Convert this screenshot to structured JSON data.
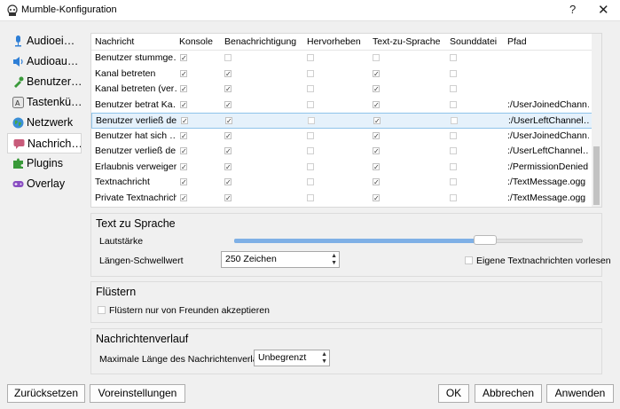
{
  "window": {
    "title": "Mumble-Konfiguration",
    "help": "?",
    "close": "✕"
  },
  "sidebar": {
    "items": [
      {
        "label": "Audioei…",
        "icon": "microphone-icon"
      },
      {
        "label": "Audioau…",
        "icon": "speaker-icon"
      },
      {
        "label": "Benutzer…",
        "icon": "user-interface-icon"
      },
      {
        "label": "Tastenkü…",
        "icon": "keyboard-icon"
      },
      {
        "label": "Netzwerk",
        "icon": "globe-icon"
      },
      {
        "label": "Nachrich…",
        "icon": "message-bubble-icon"
      },
      {
        "label": "Plugins",
        "icon": "puzzle-icon"
      },
      {
        "label": "Overlay",
        "icon": "gamepad-icon"
      }
    ],
    "selected_index": 5
  },
  "messages_table": {
    "headers": [
      "Nachricht",
      "Konsole",
      "Benachrichtigung",
      "Hervorheben",
      "Text-zu-Sprache",
      "Sounddatei",
      "Pfad"
    ],
    "rows": [
      {
        "message": "Benutzer stummge…",
        "console": true,
        "notification": false,
        "highlight": false,
        "tts": false,
        "sound": false,
        "path": ""
      },
      {
        "message": "Kanal betreten",
        "console": true,
        "notification": true,
        "highlight": false,
        "tts": true,
        "sound": false,
        "path": ""
      },
      {
        "message": "Kanal betreten (ver…",
        "console": true,
        "notification": true,
        "highlight": false,
        "tts": true,
        "sound": false,
        "path": ""
      },
      {
        "message": "Benutzer betrat Ka…",
        "console": true,
        "notification": true,
        "highlight": false,
        "tts": true,
        "sound": false,
        "path": ":/UserJoinedChann…"
      },
      {
        "message": "Benutzer verließ de…",
        "console": true,
        "notification": true,
        "highlight": false,
        "tts": true,
        "sound": false,
        "path": ":/UserLeftChannel…",
        "selected": true
      },
      {
        "message": "Benutzer hat sich …",
        "console": true,
        "notification": true,
        "highlight": false,
        "tts": true,
        "sound": false,
        "path": ":/UserJoinedChann…"
      },
      {
        "message": "Benutzer verließ de…",
        "console": true,
        "notification": true,
        "highlight": false,
        "tts": true,
        "sound": false,
        "path": ":/UserLeftChannel…"
      },
      {
        "message": "Erlaubnis verweigert",
        "console": true,
        "notification": true,
        "highlight": false,
        "tts": true,
        "sound": false,
        "path": ":/PermissionDenied…"
      },
      {
        "message": "Textnachricht",
        "console": true,
        "notification": true,
        "highlight": false,
        "tts": true,
        "sound": false,
        "path": ":/TextMessage.ogg"
      },
      {
        "message": "Private Textnachricht",
        "console": true,
        "notification": true,
        "highlight": false,
        "tts": true,
        "sound": false,
        "path": ":/TextMessage.ogg"
      }
    ]
  },
  "tts_group": {
    "title": "Text zu Sprache",
    "volume_label": "Lautstärke",
    "volume_fraction": 0.72,
    "threshold_label": "Längen-Schwellwert",
    "threshold_value": "250 Zeichen",
    "read_own_label": "Eigene Textnachrichten vorlesen",
    "read_own_checked": false
  },
  "whisper_group": {
    "title": "Flüstern",
    "friends_only_label": "Flüstern nur von Freunden akzeptieren",
    "friends_only_checked": false
  },
  "history_group": {
    "title": "Nachrichtenverlauf",
    "max_length_label": "Maximale Länge des Nachrichtenverlaufs",
    "max_length_value": "Unbegrenzt"
  },
  "buttons": {
    "reset": "Zurücksetzen",
    "defaults": "Voreinstellungen",
    "ok": "OK",
    "cancel": "Abbrechen",
    "apply": "Anwenden"
  },
  "colors": {
    "accent": "#7fb0e6",
    "selection": "#e5f1fb",
    "selection_border": "#8ec3ea"
  }
}
